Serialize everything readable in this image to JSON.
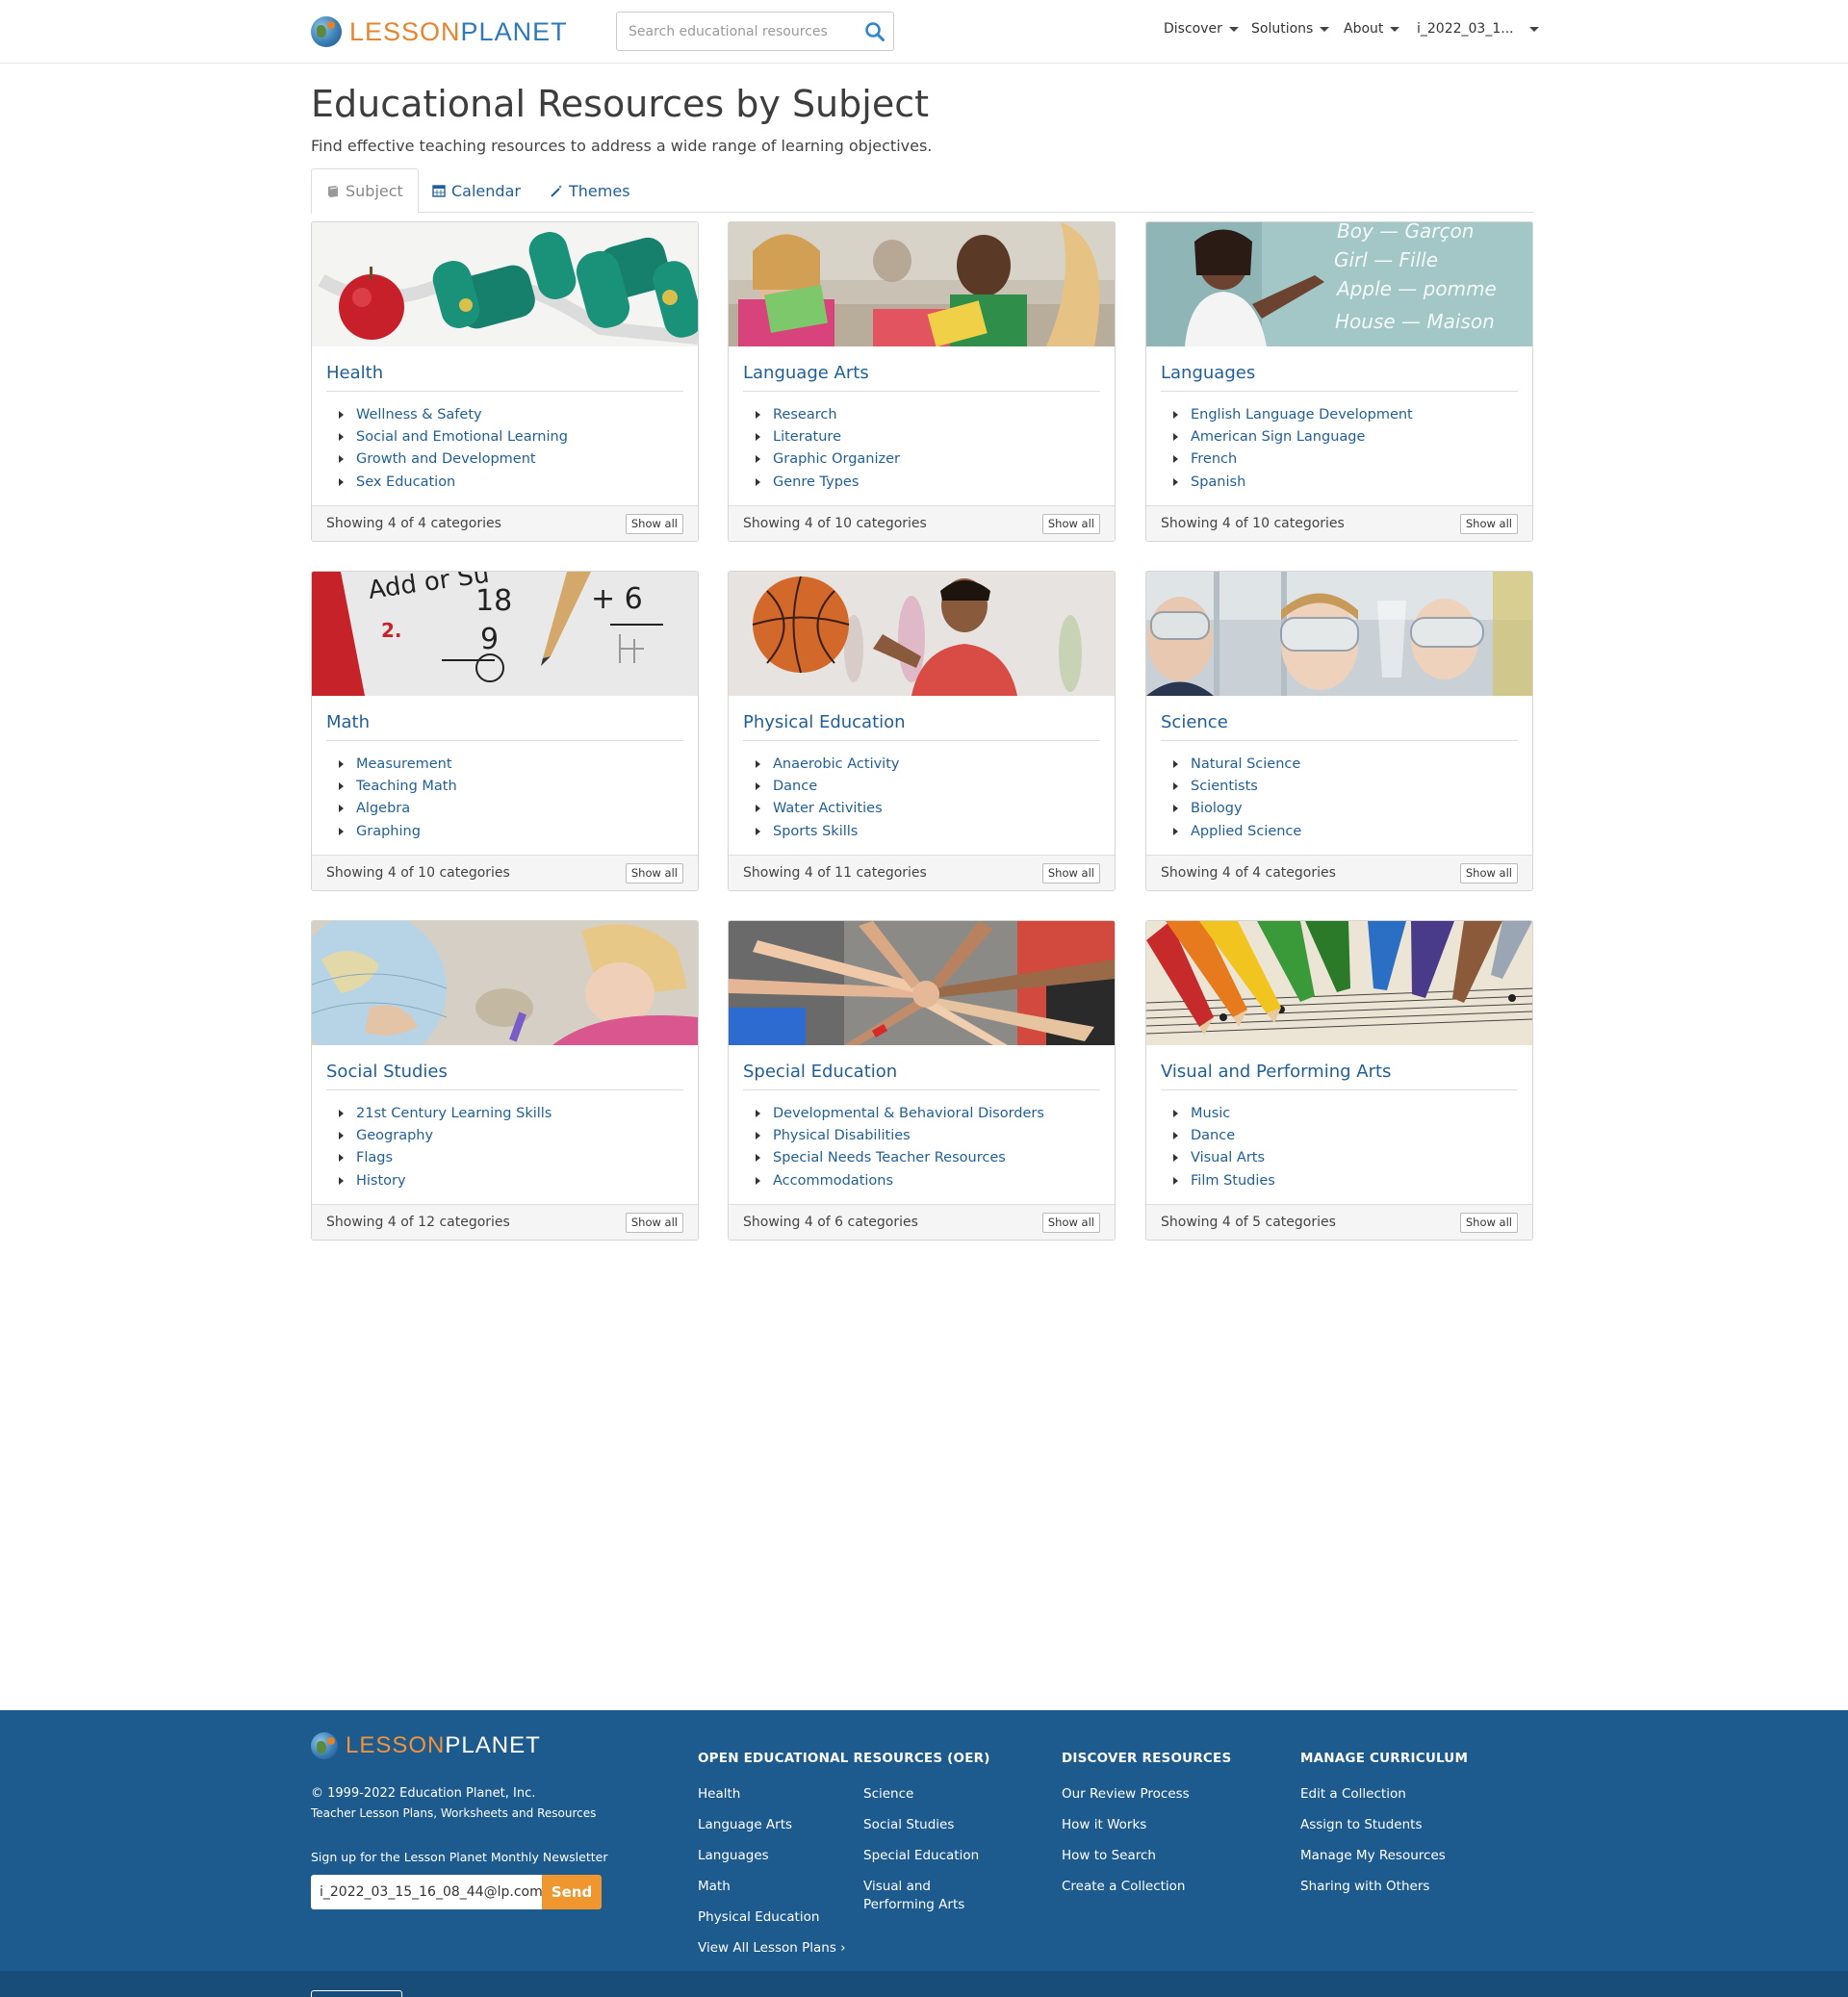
{
  "header": {
    "logo": {
      "part1": "LESSON",
      "part2": "PLANET"
    },
    "search_placeholder": "Search educational resources",
    "nav": [
      "Discover",
      "Solutions",
      "About",
      "i_2022_03_1..."
    ]
  },
  "page": {
    "title": "Educational Resources by Subject",
    "subtitle": "Find effective teaching resources to address a wide range of learning objectives."
  },
  "tabs": [
    {
      "label": "Subject",
      "icon": "book-icon"
    },
    {
      "label": "Calendar",
      "icon": "calendar-icon"
    },
    {
      "label": "Themes",
      "icon": "magic-wand-icon"
    }
  ],
  "cards": [
    {
      "title": "Health",
      "items": [
        "Wellness & Safety",
        "Social and Emotional Learning",
        "Growth and Development",
        "Sex Education"
      ],
      "footer": "Showing 4 of 4 categories",
      "button": "Show all"
    },
    {
      "title": "Language Arts",
      "items": [
        "Research",
        "Literature",
        "Graphic Organizer",
        "Genre Types"
      ],
      "footer": "Showing 4 of 10 categories",
      "button": "Show all"
    },
    {
      "title": "Languages",
      "items": [
        "English Language Development",
        "American Sign Language",
        "French",
        "Spanish"
      ],
      "footer": "Showing 4 of 10 categories",
      "button": "Show all",
      "image_text": [
        "Boy — Garçon",
        "Girl — Fille",
        "Apple — pomme",
        "House — Maison"
      ]
    },
    {
      "title": "Math",
      "items": [
        "Measurement",
        "Teaching Math",
        "Algebra",
        "Graphing"
      ],
      "footer": "Showing 4 of 10 categories",
      "button": "Show all",
      "image_text": [
        "Add or Su",
        "18",
        "2.",
        "9",
        "+ 6"
      ]
    },
    {
      "title": "Physical Education",
      "items": [
        "Anaerobic Activity",
        "Dance",
        "Water Activities",
        "Sports Skills"
      ],
      "footer": "Showing 4 of 11 categories",
      "button": "Show all"
    },
    {
      "title": "Science",
      "items": [
        "Natural Science",
        "Scientists",
        "Biology",
        "Applied Science"
      ],
      "footer": "Showing 4 of 4 categories",
      "button": "Show all"
    },
    {
      "title": "Social Studies",
      "items": [
        "21st Century Learning Skills",
        "Geography",
        "Flags",
        "History"
      ],
      "footer": "Showing 4 of 12 categories",
      "button": "Show all"
    },
    {
      "title": "Special Education",
      "items": [
        "Developmental & Behavioral Disorders",
        "Physical Disabilities",
        "Special Needs Teacher Resources",
        "Accommodations"
      ],
      "footer": "Showing 4 of 6 categories",
      "button": "Show all"
    },
    {
      "title": "Visual and Performing Arts",
      "items": [
        "Music",
        "Dance",
        "Visual Arts",
        "Film Studies"
      ],
      "footer": "Showing 4 of 5 categories",
      "button": "Show all"
    }
  ],
  "footer": {
    "logo": {
      "part1": "LESSON",
      "part2": "PLANET"
    },
    "copyright": "© 1999-2022 Education Planet, Inc.",
    "tagline": "Teacher Lesson Plans, Worksheets and Resources",
    "newsletter_label": "Sign up for the Lesson Planet Monthly Newsletter",
    "email_value": "i_2022_03_15_16_08_44@lp.com",
    "send_label": "Send",
    "oer": {
      "heading": "OPEN EDUCATIONAL RESOURCES (OER)",
      "col1": [
        "Health",
        "Language Arts",
        "Languages",
        "Math",
        "Physical Education",
        "View All Lesson Plans ›"
      ],
      "col2": [
        "Science",
        "Social Studies",
        "Special Education",
        "Visual and Performing Arts"
      ]
    },
    "discover": {
      "heading": "DISCOVER RESOURCES",
      "items": [
        "Our Review Process",
        "How it Works",
        "How to Search",
        "Create a Collection"
      ]
    },
    "manage": {
      "heading": "MANAGE CURRICULUM",
      "items": [
        "Edit a Collection",
        "Assign to Students",
        "Manage My Resources",
        "Sharing with Others"
      ]
    }
  }
}
